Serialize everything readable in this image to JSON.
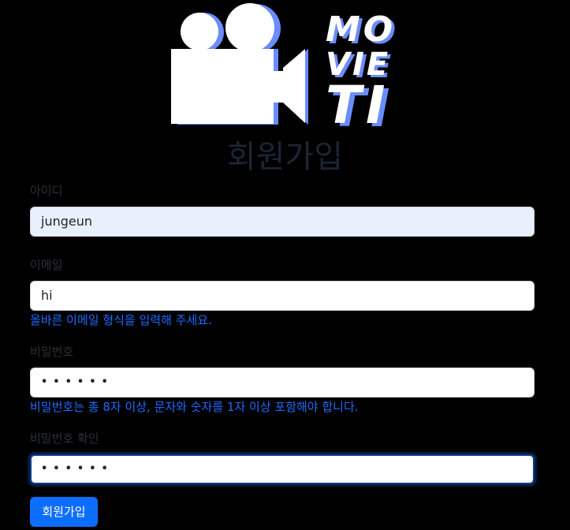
{
  "logo": {
    "line1": "MO",
    "line2": "VIE",
    "line3": "TI",
    "accent_color": "#6b8cff"
  },
  "page_title": "회원가입",
  "fields": {
    "username": {
      "label": "아이디",
      "value": "jungeun"
    },
    "email": {
      "label": "이메일",
      "value": "hi",
      "error": "올바른 이메일 형식을 입력해 주세요."
    },
    "password": {
      "label": "비밀번호",
      "value": "••••••",
      "error": "비밀번호는 총 8자 이상, 문자와 숫자를 1자 이상 포함해야 합니다."
    },
    "password_confirm": {
      "label": "비밀번호 확인",
      "value": "••••••"
    }
  },
  "submit_label": "회원가입",
  "colors": {
    "background": "#000000",
    "primary": "#0d6efd",
    "error_text": "#1f6bff",
    "label_text": "#2a313b",
    "title_text": "#1c2534"
  }
}
